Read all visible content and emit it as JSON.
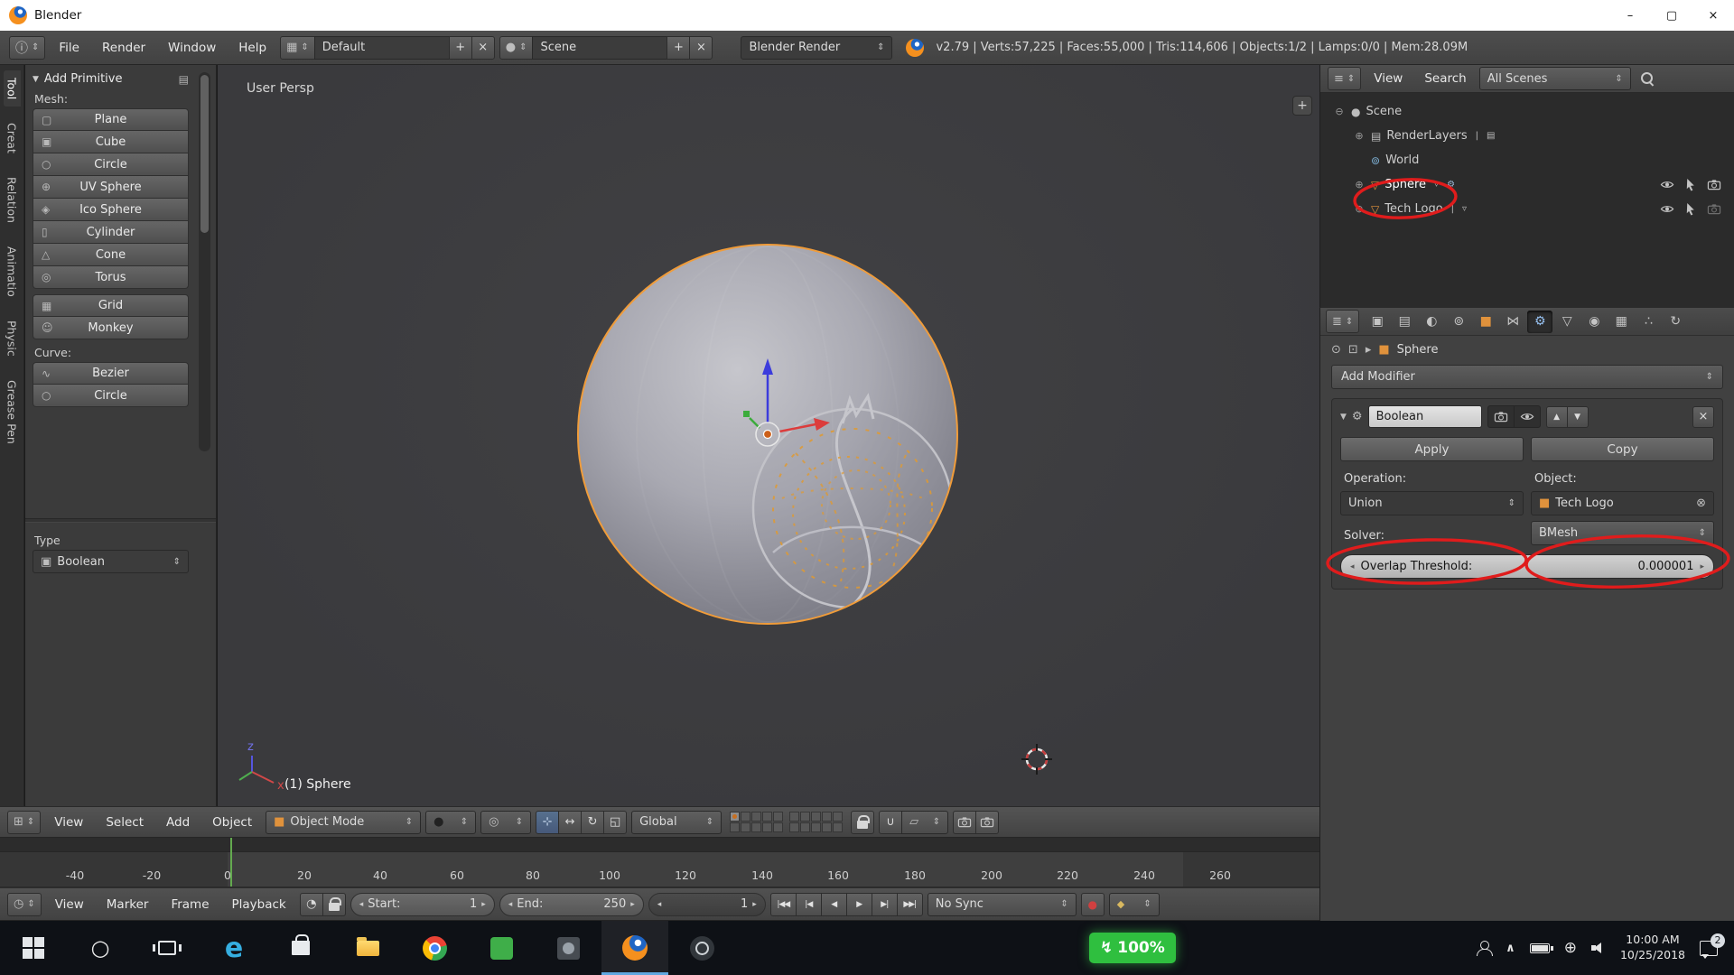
{
  "titlebar": {
    "app_name": "Blender",
    "minimize": "–",
    "maximize": "▢",
    "close": "×"
  },
  "infobar": {
    "menus": [
      "File",
      "Render",
      "Window",
      "Help"
    ],
    "layout_value": "Default",
    "scene_value": "Scene",
    "engine_value": "Blender Render",
    "stats": "v2.79 | Verts:57,225 | Faces:55,000 | Tris:114,606 | Objects:1/2 | Lamps:0/0 | Mem:28.09M"
  },
  "toolshelf": {
    "tabs": [
      "Tool",
      "Creat",
      "Relation",
      "Animatio",
      "Physic",
      "Grease Pen"
    ],
    "panel_title": "Add Primitive",
    "mesh_label": "Mesh:",
    "mesh_buttons": [
      "Plane",
      "Cube",
      "Circle",
      "UV Sphere",
      "Ico Sphere",
      "Cylinder",
      "Cone",
      "Torus",
      "Grid",
      "Monkey"
    ],
    "mesh_icons": [
      "▢",
      "▣",
      "○",
      "⊕",
      "◈",
      "▯",
      "△",
      "◎",
      "▦",
      "☺"
    ],
    "curve_label": "Curve:",
    "curve_buttons": [
      "Bezier",
      "Circle"
    ],
    "curve_icons": [
      "∿",
      "○"
    ],
    "redo_label": "Type",
    "redo_value": "Boolean"
  },
  "viewport": {
    "view_label": "User Persp",
    "status_label": "(1) Sphere",
    "axis_z": "z",
    "axis_x": "x",
    "header": {
      "menus": [
        "View",
        "Select",
        "Add",
        "Object"
      ],
      "mode_value": "Object Mode",
      "orientation_value": "Global"
    }
  },
  "timeline": {
    "ticks": [
      "-40",
      "-20",
      "0",
      "20",
      "40",
      "60",
      "80",
      "100",
      "120",
      "140",
      "160",
      "180",
      "200",
      "220",
      "240",
      "260"
    ],
    "header": {
      "menus": [
        "View",
        "Marker",
        "Frame",
        "Playback"
      ],
      "start_label": "Start:",
      "start_value": "1",
      "end_label": "End:",
      "end_value": "250",
      "current_frame": "1",
      "sync_value": "No Sync"
    }
  },
  "outliner": {
    "menus": [
      "View",
      "Search"
    ],
    "filter_value": "All Scenes",
    "rows": [
      {
        "label": "Scene"
      },
      {
        "label": "RenderLayers"
      },
      {
        "label": "World"
      },
      {
        "label": "Sphere"
      },
      {
        "label": "Tech Logo"
      }
    ]
  },
  "properties": {
    "tabs": [
      {
        "name": "render",
        "glyph": "▣"
      },
      {
        "name": "render-layers",
        "glyph": "▤"
      },
      {
        "name": "scene",
        "glyph": "◐"
      },
      {
        "name": "world",
        "glyph": "⊚"
      },
      {
        "name": "object",
        "glyph": "■"
      },
      {
        "name": "constraints",
        "glyph": "⋈"
      },
      {
        "name": "modifiers",
        "glyph": "⚙"
      },
      {
        "name": "data",
        "glyph": "▽"
      },
      {
        "name": "material",
        "glyph": "◉"
      },
      {
        "name": "texture",
        "glyph": "▦"
      },
      {
        "name": "particles",
        "glyph": "∴"
      },
      {
        "name": "physics",
        "glyph": "↻"
      }
    ],
    "breadcrumb_object": "Sphere",
    "add_modifier_label": "Add Modifier",
    "modifier": {
      "name_value": "Boolean",
      "apply_label": "Apply",
      "copy_label": "Copy",
      "operation_label": "Operation:",
      "operation_value": "Union",
      "object_label": "Object:",
      "object_value": "Tech Logo",
      "solver_label": "Solver:",
      "solver_value": "BMesh",
      "threshold_label": "Overlap Threshold:",
      "threshold_value": "0.000001"
    }
  },
  "taskbar": {
    "battery_text": "100%",
    "clock_time": "10:00 AM",
    "clock_date": "10/25/2018",
    "notification_count": "2"
  },
  "colors": {
    "selection_orange": "#f09c3a",
    "annotation_red": "#e01c1c",
    "battery_green": "#2fbf3f"
  },
  "icons": {
    "arrows": "⇕",
    "tri_down": "▼",
    "tri_up": "▲",
    "tri_left": "◂",
    "tri_right": "▸",
    "plus": "+",
    "x": "×",
    "remove": "⊗",
    "pipe": "|",
    "info": "ⓘ",
    "screen_layout": "▦",
    "scene_ball": "●",
    "editor_3d": "⊞",
    "editor_outliner": "≡",
    "editor_props": "≣",
    "editor_timeline": "◷",
    "panel_menu": "▤",
    "expand": "⊕",
    "collapse_node": "⊖",
    "renderlayers": "▤",
    "world": "⊚",
    "mesh_data": "▽",
    "mesh_data_mod": "▿",
    "wrench": "⚙",
    "object_cube": "■",
    "shading_sphere": "●",
    "pivot": "◎",
    "manipulator": "⊹",
    "translate": "↔",
    "rotate": "↻",
    "scale": "◱",
    "magnet": "∪",
    "snap_element": "▱",
    "record": "●",
    "keying": "◆",
    "preview_range": "◔",
    "jump_start": "|◀◀",
    "prev_key": "|◀",
    "play_rev": "◀",
    "play": "▶",
    "next_key": "▶|",
    "jump_end": "▶▶|",
    "pin": "⊙",
    "crumb_node": "⊡",
    "crumb_arrow": "▸",
    "boolean": "▣",
    "bolt": "↯",
    "caret_up": "∧",
    "globe": "⊕",
    "cortana": "○",
    "edge": "e"
  }
}
